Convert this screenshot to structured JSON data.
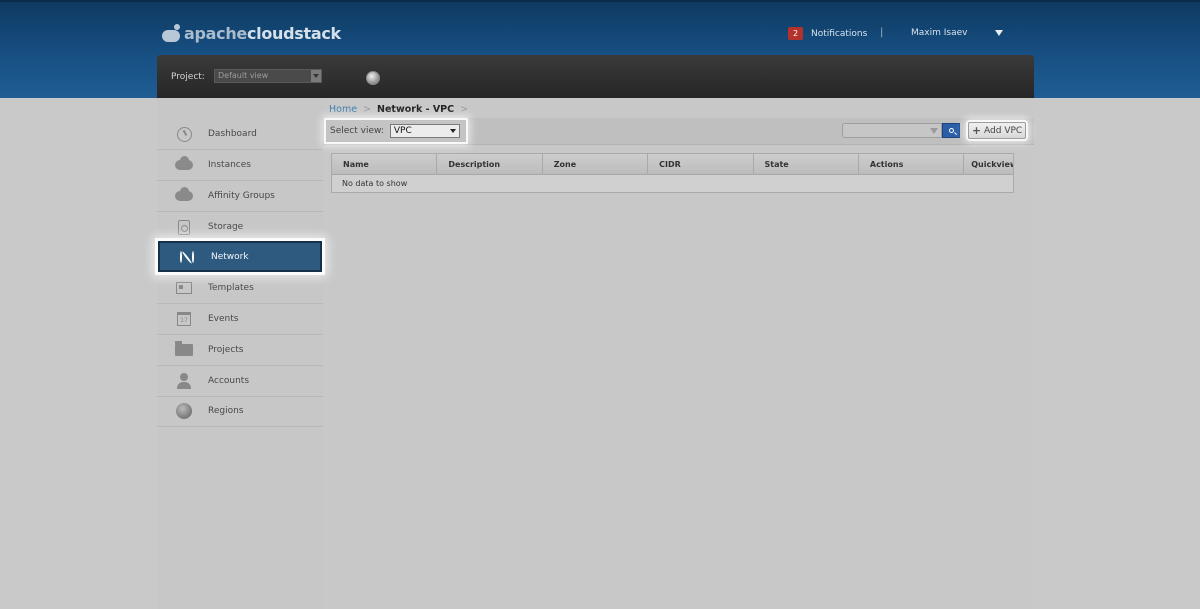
{
  "header": {
    "logo_prefix": "apache",
    "logo_brand": "cloudstack",
    "notifications_count": "2",
    "notifications_label": "Notifications",
    "separator": "|",
    "user_name": "Maxim Isaev"
  },
  "project_bar": {
    "label": "Project:",
    "selected": "Default view"
  },
  "sidebar": {
    "items": [
      {
        "label": "Dashboard",
        "icon": "dashboard-icon"
      },
      {
        "label": "Instances",
        "icon": "cloud-icon"
      },
      {
        "label": "Affinity Groups",
        "icon": "affinity-icon"
      },
      {
        "label": "Storage",
        "icon": "storage-icon"
      },
      {
        "label": "Network",
        "icon": "network-icon",
        "active": true
      },
      {
        "label": "Templates",
        "icon": "templates-icon"
      },
      {
        "label": "Events",
        "icon": "calendar-icon"
      },
      {
        "label": "Projects",
        "icon": "folder-icon"
      },
      {
        "label": "Accounts",
        "icon": "user-icon"
      },
      {
        "label": "Regions",
        "icon": "globe-icon"
      }
    ],
    "events_icon_text": "17"
  },
  "breadcrumb": {
    "home": "Home",
    "sep": ">",
    "current": "Network - VPC"
  },
  "toolbar": {
    "select_view_label": "Select view:",
    "select_view_value": "VPC",
    "add_label": "Add VPC",
    "add_icon": "+"
  },
  "table": {
    "columns": [
      "Name",
      "Description",
      "Zone",
      "CIDR",
      "State",
      "Actions",
      "Quickview"
    ],
    "empty_message": "No data to show"
  },
  "colors": {
    "header_blue": "#174f82",
    "active_nav": "#2e5a80",
    "notification_badge": "#b5312c",
    "search_button": "#2a5fa8"
  }
}
